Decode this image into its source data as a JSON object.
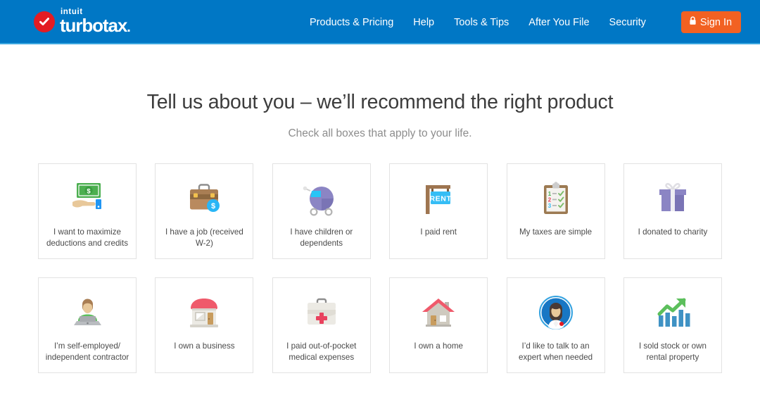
{
  "header": {
    "logo": {
      "intuit": "intuit",
      "product": "turbotax",
      "check_icon": "check-icon"
    },
    "nav": [
      {
        "label": "Products & Pricing"
      },
      {
        "label": "Help"
      },
      {
        "label": "Tools & Tips"
      },
      {
        "label": "After You File"
      },
      {
        "label": "Security"
      }
    ],
    "signin": {
      "label": "Sign In",
      "icon": "lock-icon"
    },
    "bg_color": "#0077c5",
    "signin_color": "#f26122"
  },
  "main": {
    "headline": "Tell us about you – we’ll recommend the right product",
    "subhead": "Check all boxes that apply to your life.",
    "cards": [
      {
        "label": "I want to maximize deductions and credits",
        "icon": "money-in-hand-icon"
      },
      {
        "label": "I have a job (received W-2)",
        "icon": "briefcase-icon"
      },
      {
        "label": "I have children or dependents",
        "icon": "baby-carriage-icon"
      },
      {
        "label": "I paid rent",
        "icon": "rent-sign-icon"
      },
      {
        "label": "My taxes are simple",
        "icon": "clipboard-checklist-icon"
      },
      {
        "label": "I donated to charity",
        "icon": "gift-box-icon"
      },
      {
        "label": "I’m self-employed/ independent contractor",
        "icon": "person-laptop-icon"
      },
      {
        "label": "I own a business",
        "icon": "storefront-icon"
      },
      {
        "label": "I paid out-of-pocket medical expenses",
        "icon": "first-aid-kit-icon"
      },
      {
        "label": "I own a home",
        "icon": "house-icon"
      },
      {
        "label": "I’d like to talk to an expert when needed",
        "icon": "expert-avatar-icon"
      },
      {
        "label": "I sold stock or own rental property",
        "icon": "growth-chart-icon"
      }
    ]
  }
}
